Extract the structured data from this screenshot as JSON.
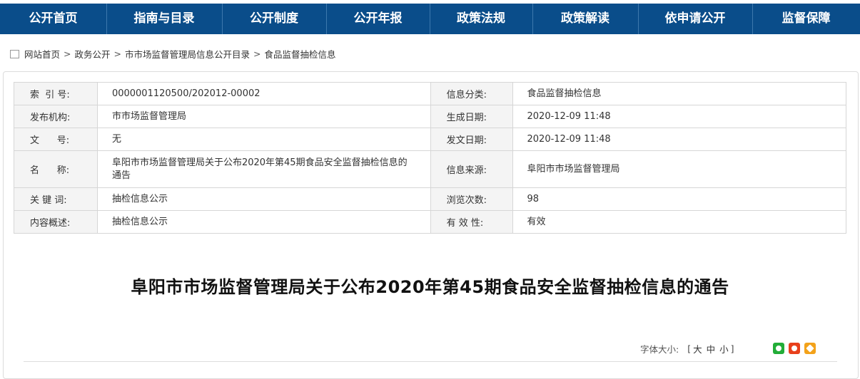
{
  "nav": {
    "items": [
      {
        "label": "公开首页"
      },
      {
        "label": "指南与目录"
      },
      {
        "label": "公开制度"
      },
      {
        "label": "公开年报"
      },
      {
        "label": "政策法规"
      },
      {
        "label": "政策解读"
      },
      {
        "label": "依申请公开"
      },
      {
        "label": "监督保障"
      }
    ]
  },
  "breadcrumb": {
    "items": [
      "网站首页",
      "政务公开",
      "市市场监督管理局信息公开目录",
      "食品监督抽检信息"
    ],
    "separator": ">"
  },
  "meta": {
    "rows": [
      {
        "k1": "索  引 号:",
        "v1": "0000001120500/202012-00002",
        "k2": "信息分类:",
        "v2": "食品监督抽检信息"
      },
      {
        "k1": "发布机构:",
        "v1": "市市场监督管理局",
        "k2": "生成日期:",
        "v2": "2020-12-09 11:48"
      },
      {
        "k1": "文      号:",
        "v1": "无",
        "k2": "发文日期:",
        "v2": "2020-12-09 11:48"
      },
      {
        "k1": "名      称:",
        "v1": "阜阳市市场监督管理局关于公布2020年第45期食品安全监督抽检信息的通告",
        "k2": "信息来源:",
        "v2": "阜阳市市场监督管理局"
      },
      {
        "k1": "关 键 词:",
        "v1": "抽检信息公示",
        "k2": "浏览次数:",
        "v2": "98"
      },
      {
        "k1": "内容概述:",
        "v1": "抽检信息公示",
        "k2": "有 效 性:",
        "v2": "有效"
      }
    ]
  },
  "article": {
    "title": "阜阳市市场监督管理局关于公布2020年第45期食品安全监督抽检信息的通告"
  },
  "tools": {
    "font_size_label": "字体大小:",
    "open_bracket": "[",
    "close_bracket": "]",
    "sizes": [
      "大",
      "中",
      "小"
    ]
  },
  "share": {
    "icons": [
      "wechat-icon",
      "weibo-icon",
      "favorite-icon"
    ],
    "colors": {
      "wechat": "#22ad38",
      "weibo": "#e8401c",
      "favorite": "#f3a21a"
    }
  },
  "colors": {
    "nav_bg": "#0a4d8a"
  }
}
